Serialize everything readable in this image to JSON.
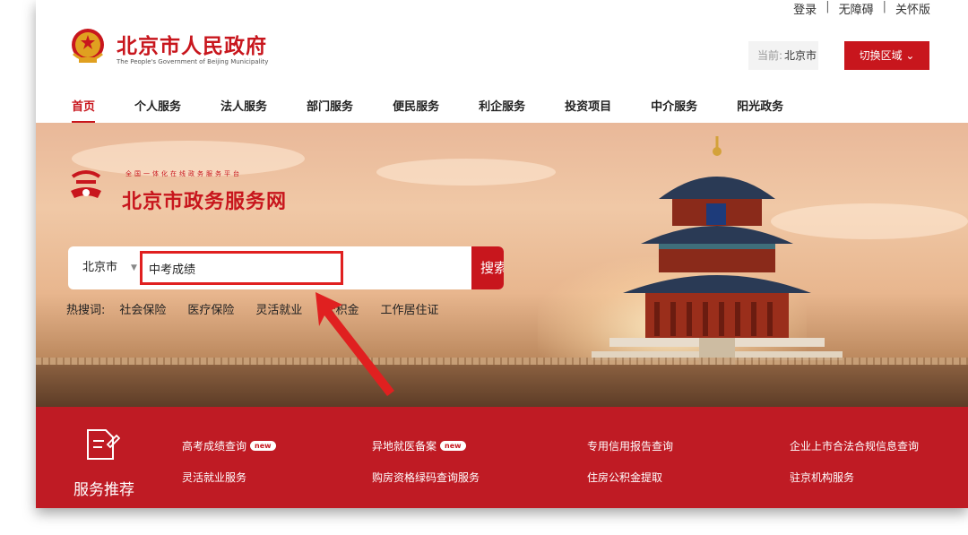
{
  "utility": {
    "login": "登录",
    "accessible": "无障碍",
    "care_mode": "关怀版",
    "separator": "|"
  },
  "header": {
    "title": "北京市人民政府",
    "subtitle": "The People's Government of Beijing Municipality",
    "current_region_label": "当前:",
    "current_region_value": "北京市",
    "switch_region": "切换区域 ⌄"
  },
  "nav": {
    "items": [
      {
        "label": "首页",
        "active": true
      },
      {
        "label": "个人服务"
      },
      {
        "label": "法人服务"
      },
      {
        "label": "部门服务"
      },
      {
        "label": "便民服务"
      },
      {
        "label": "利企服务"
      },
      {
        "label": "投资项目"
      },
      {
        "label": "中介服务"
      },
      {
        "label": "阳光政务"
      }
    ]
  },
  "portal": {
    "slogan": "全国一体化在线政务服务平台",
    "title": "北京市政务服务网"
  },
  "search": {
    "region": "北京市",
    "caret": "▼",
    "value": "中考成绩",
    "button_label": "搜索"
  },
  "hot_words": {
    "label": "热搜词:",
    "items": [
      "社会保险",
      "医疗保险",
      "灵活就业",
      "公积金",
      "工作居住证"
    ]
  },
  "services": {
    "title": "服务推荐",
    "new_badge": "new",
    "items": [
      {
        "label": "高考成绩查询",
        "new": true
      },
      {
        "label": "异地就医备案",
        "new": true
      },
      {
        "label": "专用信用报告查询"
      },
      {
        "label": "企业上市合法合规信息查询"
      },
      {
        "label": "灵活就业服务"
      },
      {
        "label": "购房资格绿码查询服务"
      },
      {
        "label": "住房公积金提取"
      },
      {
        "label": "驻京机构服务"
      }
    ]
  },
  "colors": {
    "brand_red": "#c8161d",
    "service_band": "#bf1b24",
    "highlight_box": "#e02020"
  }
}
